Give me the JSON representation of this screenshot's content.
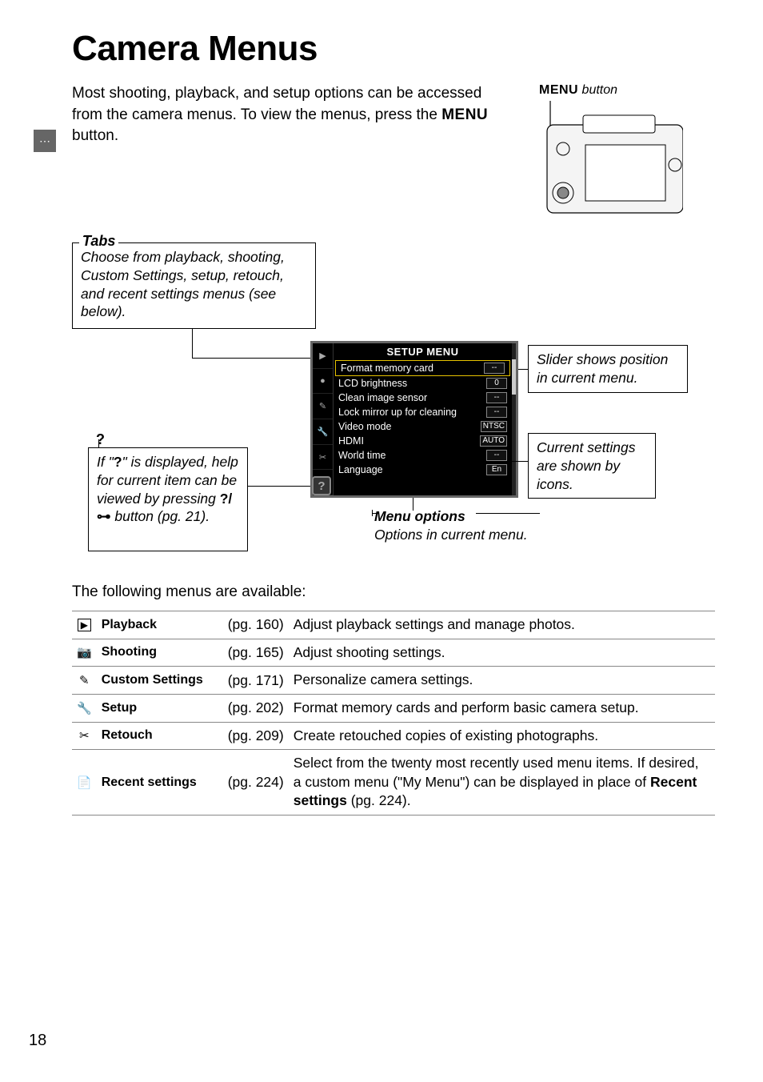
{
  "page_number": "18",
  "title": "Camera Menus",
  "intro_before_menu": "Most shooting, playback, and setup options can be accessed from the camera menus.  To view the menus, press the ",
  "menu_word": "MENU",
  "intro_after_menu": " button.",
  "menu_button_label_prefix": "MENU",
  "menu_button_label_suffix": " button",
  "callouts": {
    "tabs_title": "Tabs",
    "tabs_body": "Choose from playback, shooting, Custom Settings, setup, retouch, and recent settings menus (see below).",
    "slider": "Slider shows position in current menu.",
    "current": "Current settings are shown by icons.",
    "help_line1": "If \"",
    "help_q": "?",
    "help_line2": "\" is displayed, help for current item can be viewed by pressing ",
    "help_btn": "?/⊶",
    "help_line3": " button (pg. 21).",
    "menuopts_title": "Menu options",
    "menuopts_body": "Options in current menu."
  },
  "lcd": {
    "title": "SETUP MENU",
    "rows": [
      {
        "label": "Format memory card",
        "val": "--"
      },
      {
        "label": "LCD brightness",
        "val": "0"
      },
      {
        "label": "Clean image sensor",
        "val": "--"
      },
      {
        "label": "Lock mirror up for cleaning",
        "val": "--"
      },
      {
        "label": "Video mode",
        "val": "NTSC"
      },
      {
        "label": "HDMI",
        "val": "AUTO"
      },
      {
        "label": "World time",
        "val": "--"
      },
      {
        "label": "Language",
        "val": "En"
      }
    ]
  },
  "below_text": "The following menus are available:",
  "menus": [
    {
      "icon": "▶",
      "name": "Playback",
      "pg": "(pg. 160)",
      "desc": "Adjust playback settings and manage photos."
    },
    {
      "icon": "📷",
      "name": "Shooting",
      "pg": "(pg. 165)",
      "desc": "Adjust shooting settings."
    },
    {
      "icon": "✎",
      "name": "Custom Settings",
      "pg": "(pg. 171)",
      "desc": "Personalize camera settings."
    },
    {
      "icon": "🔧",
      "name": "Setup",
      "pg": "(pg. 202)",
      "desc": "Format memory cards and perform basic camera setup."
    },
    {
      "icon": "✂",
      "name": "Retouch",
      "pg": "(pg. 209)",
      "desc": "Create retouched copies of existing photographs."
    },
    {
      "icon": "📄",
      "name": "Recent settings",
      "pg": "(pg. 224)",
      "desc_pre": "Select from the twenty most recently used menu items.  If desired, a custom menu (\"My Menu\") can be displayed in place of ",
      "desc_bold": "Recent settings",
      "desc_post": " (pg. 224)."
    }
  ]
}
